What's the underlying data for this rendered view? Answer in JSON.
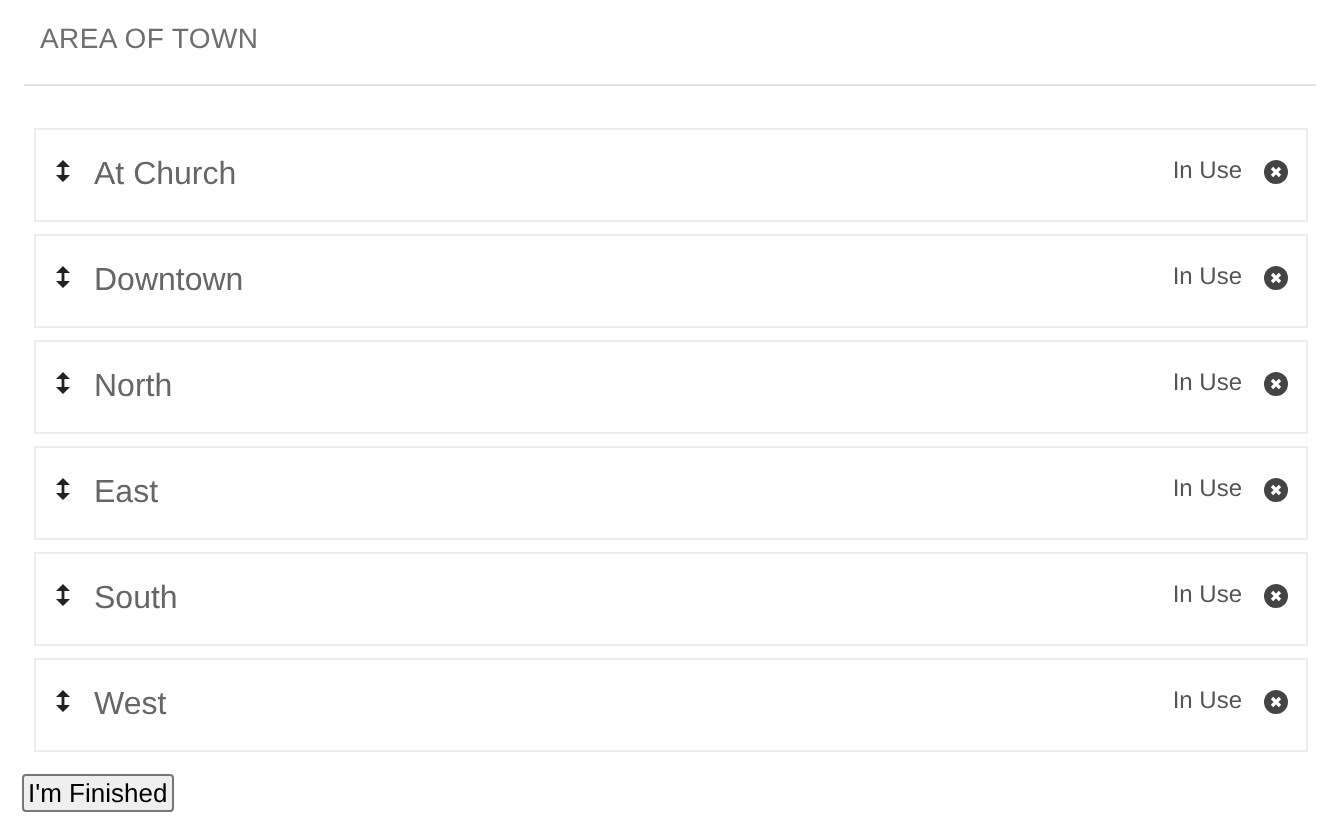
{
  "header": {
    "title": "AREA OF TOWN"
  },
  "items": [
    {
      "label": "At Church",
      "status": "In Use"
    },
    {
      "label": "Downtown",
      "status": "In Use"
    },
    {
      "label": "North",
      "status": "In Use"
    },
    {
      "label": "East",
      "status": "In Use"
    },
    {
      "label": "South",
      "status": "In Use"
    },
    {
      "label": "West",
      "status": "In Use"
    }
  ],
  "finish_button": {
    "label": "I'm Finished"
  }
}
